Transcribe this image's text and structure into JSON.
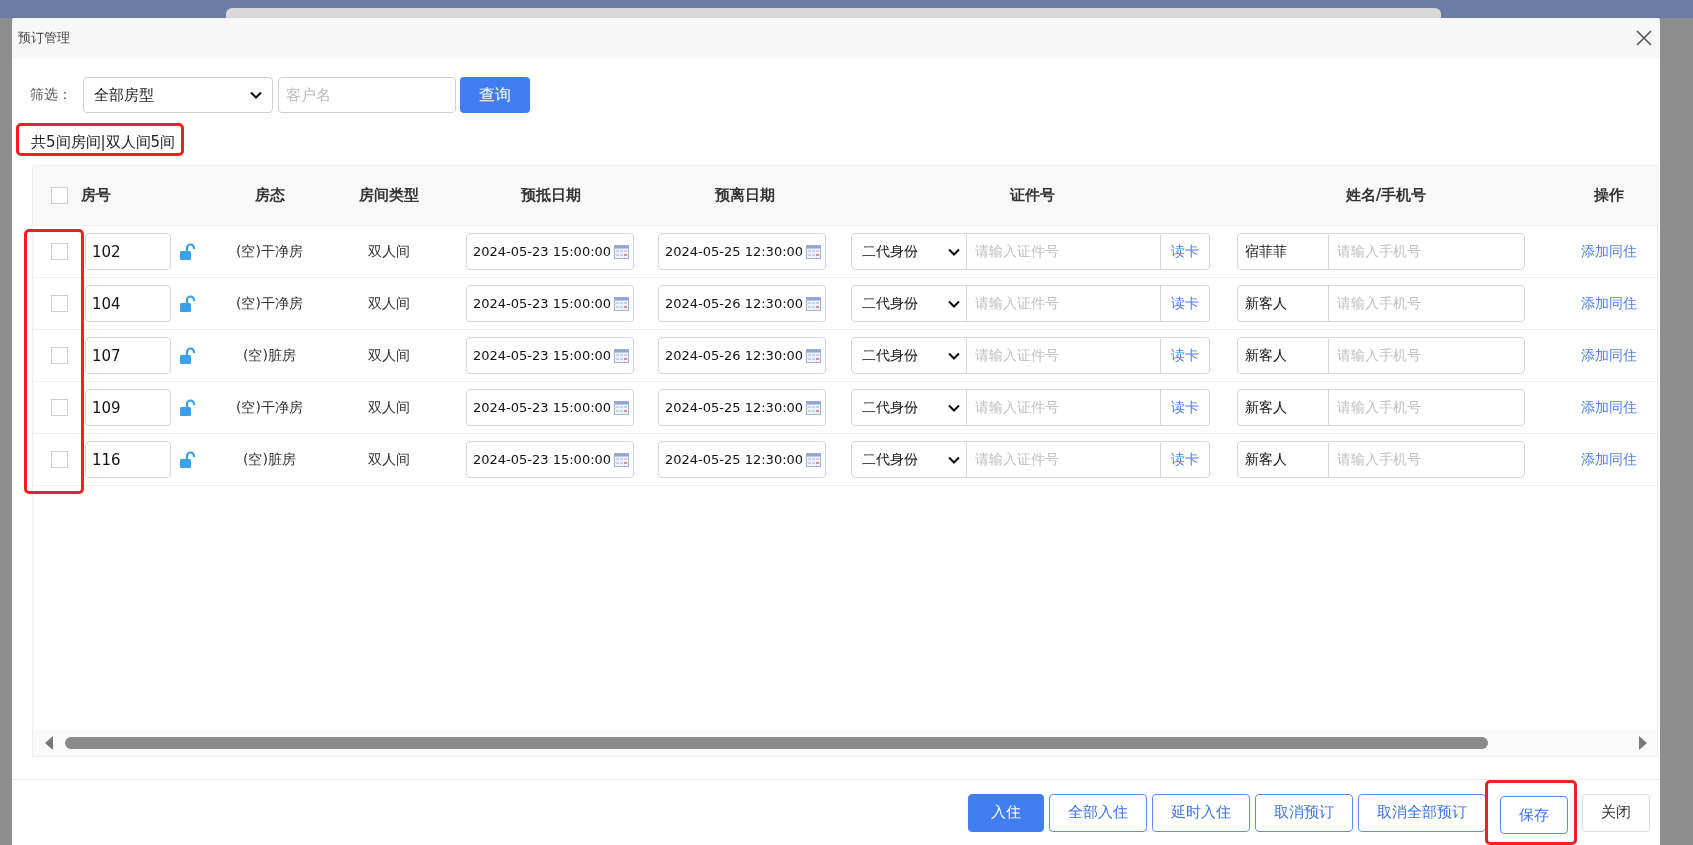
{
  "window": {
    "title": "预订管理"
  },
  "filter": {
    "label": "筛选：",
    "room_type": "全部房型",
    "customer_placeholder": "客户名",
    "search_button": "查询"
  },
  "summary": {
    "text": "共5间房间|双人间5间",
    "highlighted": true
  },
  "table": {
    "columns": [
      "房号",
      "房态",
      "房间类型",
      "预抵日期",
      "预离日期",
      "证件号",
      "姓名/手机号",
      "操作"
    ],
    "all_checked": false,
    "checkbox_column_highlighted": true,
    "rows": [
      {
        "checked": false,
        "room": "102",
        "status": "(空)干净房",
        "type": "双人间",
        "arrival": "2024-05-23 15:00:00",
        "departure": "2024-05-25 12:30:00",
        "id_type": "二代身份",
        "id_placeholder": "请输入证件号",
        "read_card": "读卡",
        "name": "宿菲菲",
        "phone_placeholder": "请输入手机号",
        "action": "添加同住"
      },
      {
        "checked": false,
        "room": "104",
        "status": "(空)干净房",
        "type": "双人间",
        "arrival": "2024-05-23 15:00:00",
        "departure": "2024-05-26 12:30:00",
        "id_type": "二代身份",
        "id_placeholder": "请输入证件号",
        "read_card": "读卡",
        "name": "新客人",
        "phone_placeholder": "请输入手机号",
        "action": "添加同住"
      },
      {
        "checked": false,
        "room": "107",
        "status": "(空)脏房",
        "type": "双人间",
        "arrival": "2024-05-23 15:00:00",
        "departure": "2024-05-26 12:30:00",
        "id_type": "二代身份",
        "id_placeholder": "请输入证件号",
        "read_card": "读卡",
        "name": "新客人",
        "phone_placeholder": "请输入手机号",
        "action": "添加同住"
      },
      {
        "checked": false,
        "room": "109",
        "status": "(空)干净房",
        "type": "双人间",
        "arrival": "2024-05-23 15:00:00",
        "departure": "2024-05-25 12:30:00",
        "id_type": "二代身份",
        "id_placeholder": "请输入证件号",
        "read_card": "读卡",
        "name": "新客人",
        "phone_placeholder": "请输入手机号",
        "action": "添加同住"
      },
      {
        "checked": false,
        "room": "116",
        "status": "(空)脏房",
        "type": "双人间",
        "arrival": "2024-05-23 15:00:00",
        "departure": "2024-05-25 12:30:00",
        "id_type": "二代身份",
        "id_placeholder": "请输入证件号",
        "read_card": "读卡",
        "name": "新客人",
        "phone_placeholder": "请输入手机号",
        "action": "添加同住"
      }
    ]
  },
  "buttons": [
    {
      "label": "入住",
      "kind": "primary",
      "highlighted": false
    },
    {
      "label": "全部入住",
      "kind": "outline",
      "highlighted": false
    },
    {
      "label": "延时入住",
      "kind": "outline",
      "highlighted": false
    },
    {
      "label": "取消预订",
      "kind": "outline",
      "highlighted": false
    },
    {
      "label": "取消全部预订",
      "kind": "outline",
      "highlighted": false
    },
    {
      "label": "保存",
      "kind": "outline",
      "highlighted": true
    },
    {
      "label": "关闭",
      "kind": "plain",
      "highlighted": false
    }
  ]
}
